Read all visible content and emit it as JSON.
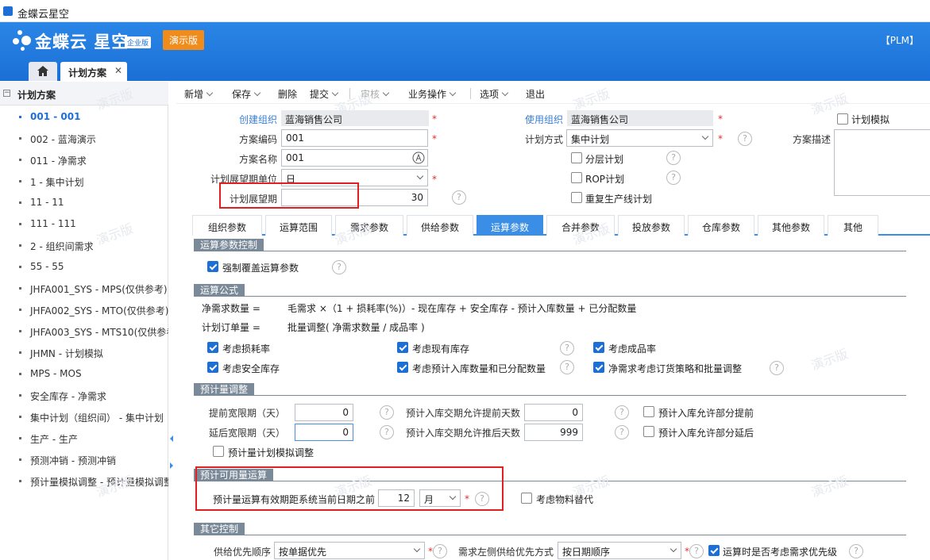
{
  "window": {
    "title": "金蝶云星空"
  },
  "banner": {
    "logo": "金蝶云 星空",
    "edition": "企业版",
    "demo_badge": "演示版",
    "plm": "【PLM】"
  },
  "tabs": {
    "active": "计划方案"
  },
  "sidebar": {
    "title": "计划方案",
    "items": [
      {
        "label": "001 - 001",
        "selected": true
      },
      {
        "label": "002 - 蓝海演示"
      },
      {
        "label": "011 - 净需求"
      },
      {
        "label": "1 - 集中计划"
      },
      {
        "label": "11 - 11"
      },
      {
        "label": "111 - 111"
      },
      {
        "label": "2 - 组织间需求"
      },
      {
        "label": "55 - 55"
      },
      {
        "label": "JHFA001_SYS - MPS(仅供参考)"
      },
      {
        "label": "JHFA002_SYS - MTO(仅供参考)"
      },
      {
        "label": "JHFA003_SYS - MTS10(仅供参考"
      },
      {
        "label": "JHMN - 计划模拟"
      },
      {
        "label": "MPS - MOS"
      },
      {
        "label": "安全库存 - 净需求"
      },
      {
        "label": "集中计划（组织间） - 集中计划"
      },
      {
        "label": "生产 - 生产"
      },
      {
        "label": "预测冲销 - 预测冲销"
      },
      {
        "label": "预计量模拟调整 - 预计量模拟调整"
      }
    ]
  },
  "toolbar": {
    "new": "新增",
    "save": "保存",
    "delete": "删除",
    "submit": "提交",
    "audit": "审核",
    "business": "业务操作",
    "options": "选项",
    "exit": "退出"
  },
  "header": {
    "create_org_label": "创建组织",
    "create_org": "蓝海销售公司",
    "use_org_label": "使用组织",
    "use_org": "蓝海销售公司",
    "plan_sim_label": "计划模拟",
    "code_label": "方案编码",
    "code": "001",
    "name_label": "方案名称",
    "name": "001",
    "plan_method_label": "计划方式",
    "plan_method": "集中计划",
    "desc_label": "方案描述",
    "layered_label": "分层计划",
    "rop_label": "ROP计划",
    "unit_label": "计划展望期单位",
    "unit": "日",
    "repeat_label": "重复生产线计划",
    "horizon_label": "计划展望期",
    "horizon": "30",
    "help": "?"
  },
  "param_tabs": [
    "组织参数",
    "运算范围",
    "需求参数",
    "供给参数",
    "运算参数",
    "合并参数",
    "投放参数",
    "仓库参数",
    "其他参数",
    "其他"
  ],
  "calc": {
    "sec1": "运算参数控制",
    "force_label": "强制覆盖运算参数",
    "sec2": "运算公式",
    "f1_label": "净需求数量 =",
    "f1": "毛需求 ×（1 + 损耗率(%)）- 现在库存 + 安全库存 - 预计入库数量 + 已分配数量",
    "f2_label": "计划订单量 =",
    "f2": "批量调整( 净需求数量 / 成品率 )",
    "cb_loss": "考虑损耗率",
    "cb_stock": "考虑现有库存",
    "cb_yield": "考虑成品率",
    "cb_safety": "考虑安全库存",
    "cb_inbound": "考虑预计入库数量和已分配数量",
    "cb_netreq": "净需求考虑订货策略和批量调整",
    "sec3": "预计量调整",
    "adv_label": "提前宽限期（天）",
    "adv": "0",
    "delay_label": "延后宽限期（天）",
    "delay": "0",
    "in_adv_label": "预计入库交期允许提前天数",
    "in_adv": "0",
    "in_delay_label": "预计入库交期允许推后天数",
    "in_delay": "999",
    "part_adv": "预计入库允许部分提前",
    "part_delay": "预计入库允许部分延后",
    "sim_adj": "预计量计划模拟调整",
    "sec4": "预计可用量运算",
    "valid_label": "预计量运算有效期距系统当前日期之前",
    "valid": "12",
    "valid_unit": "月",
    "substitute": "考虑物料替代",
    "sec5": "其它控制",
    "supply_label": "供给优先顺序",
    "supply": "按单据优先",
    "req_left_label": "需求左侧供给优先方式",
    "req_left": "按日期顺序",
    "req_priority": "运算时是否考虑需求优先级"
  },
  "watermark": "演示版"
}
